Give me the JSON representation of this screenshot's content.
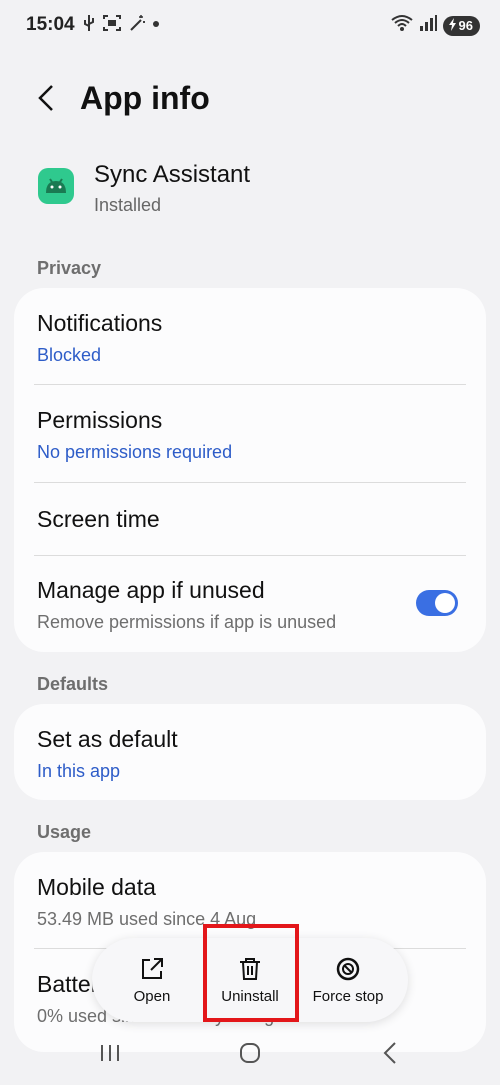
{
  "status_bar": {
    "time": "15:04",
    "battery_level": "96",
    "left_icons": [
      "usb-icon",
      "screenshot-icon",
      "magic-icon",
      "dot-icon"
    ],
    "right_icons": [
      "wifi-icon",
      "signal-icon",
      "battery-charging-icon"
    ]
  },
  "header": {
    "title": "App info",
    "back_icon": "back-arrow-icon"
  },
  "app": {
    "name": "Sync Assistant",
    "status": "Installed",
    "icon": "android-icon"
  },
  "sections": {
    "privacy": "Privacy",
    "defaults": "Defaults",
    "usage": "Usage"
  },
  "privacy_items": {
    "notifications": {
      "title": "Notifications",
      "value": "Blocked"
    },
    "permissions": {
      "title": "Permissions",
      "value": "No permissions required"
    },
    "screen_time": {
      "title": "Screen time"
    },
    "manage_unused": {
      "title": "Manage app if unused",
      "subtitle": "Remove permissions if app is unused",
      "enabled": true
    }
  },
  "defaults_items": {
    "set_default": {
      "title": "Set as default",
      "value": "In this app"
    }
  },
  "usage_items": {
    "mobile_data": {
      "title": "Mobile data",
      "subtitle": "53.49 MB used since 4 Aug"
    },
    "battery": {
      "title": "Battery",
      "subtitle": "0% used since last fully charged"
    }
  },
  "actions": {
    "open": "Open",
    "uninstall": "Uninstall",
    "force_stop": "Force stop"
  },
  "colors": {
    "accent_blue": "#2d5cc8",
    "toggle_on": "#3a6fe3",
    "highlight_red": "#e3161a",
    "app_icon_green": "#2fc98e"
  }
}
